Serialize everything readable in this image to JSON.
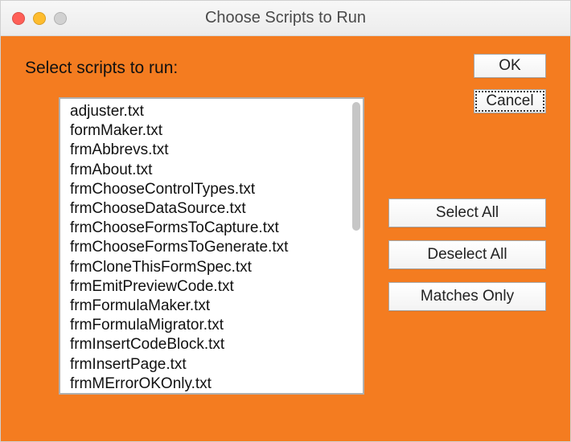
{
  "window": {
    "title": "Choose Scripts to Run"
  },
  "instruction": "Select scripts to run:",
  "buttons": {
    "ok": "OK",
    "cancel": "Cancel",
    "select_all": "Select All",
    "deselect_all": "Deselect All",
    "matches_only": "Matches Only"
  },
  "scripts": [
    "adjuster.txt",
    "formMaker.txt",
    "frmAbbrevs.txt",
    "frmAbout.txt",
    "frmChooseControlTypes.txt",
    "frmChooseDataSource.txt",
    "frmChooseFormsToCapture.txt",
    "frmChooseFormsToGenerate.txt",
    "frmCloneThisFormSpec.txt",
    "frmEmitPreviewCode.txt",
    "frmFormulaMaker.txt",
    "frmFormulaMigrator.txt",
    "frmInsertCodeBlock.txt",
    "frmInsertPage.txt",
    "frmMErrorOKOnly.txt"
  ]
}
